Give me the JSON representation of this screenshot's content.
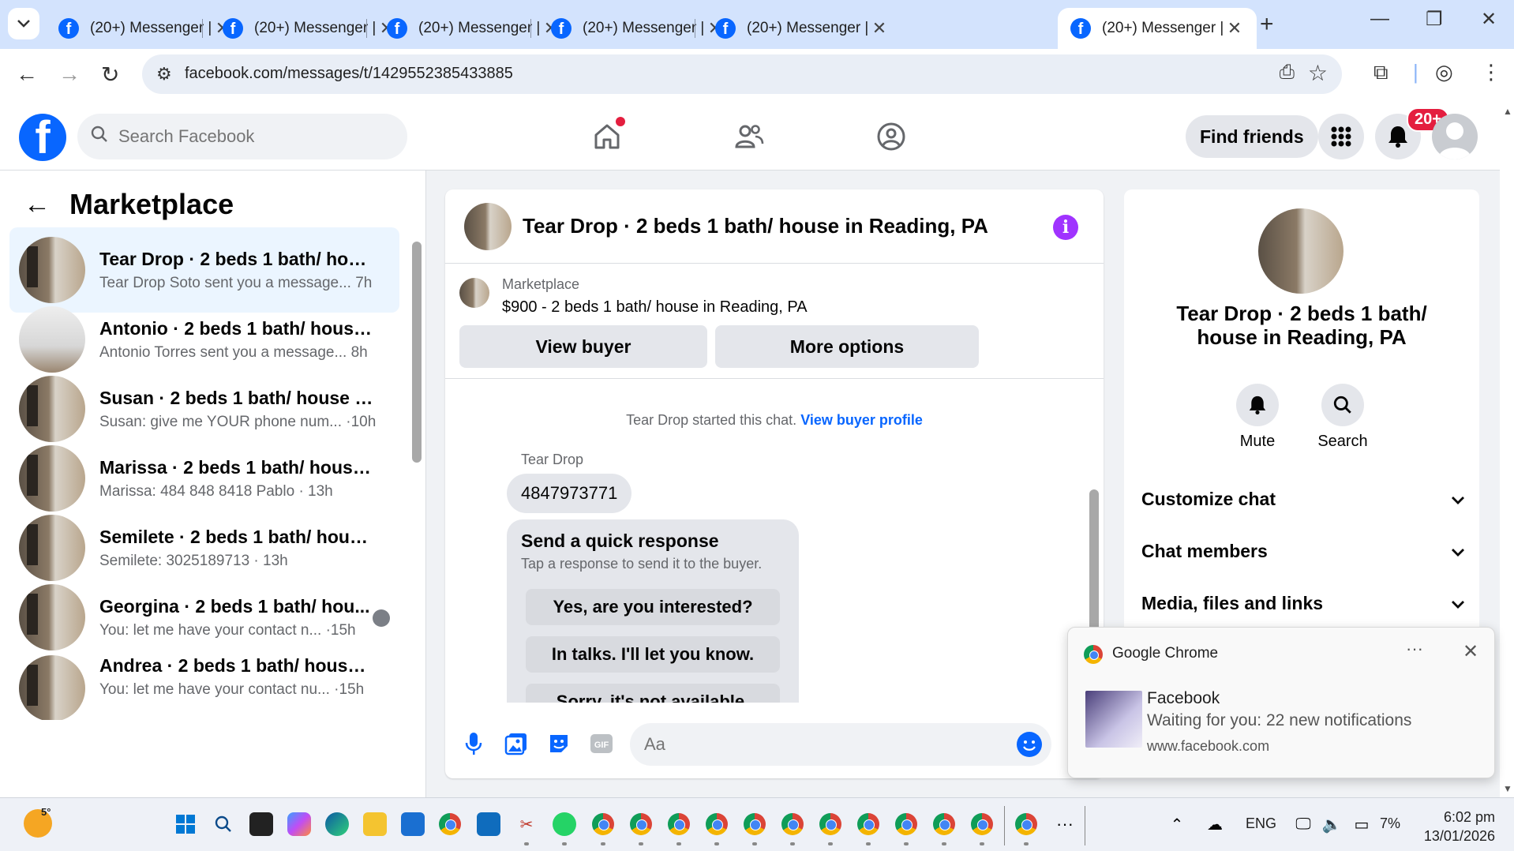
{
  "browser": {
    "tabs": [
      {
        "title": "(20+) Messenger |",
        "active": false
      },
      {
        "title": "(20+) Messenger |",
        "active": false
      },
      {
        "title": "(20+) Messenger |",
        "active": false
      },
      {
        "title": "(20+) Messenger |",
        "active": false
      },
      {
        "title": "(20+) Messenger |",
        "active": false
      },
      {
        "title": "(20+) Messenger |",
        "active": true
      }
    ],
    "url": "facebook.com/messages/t/1429552385433885"
  },
  "fb": {
    "search_placeholder": "Search Facebook",
    "find_friends": "Find friends",
    "notif_badge": "20+"
  },
  "sidebar": {
    "title": "Marketplace",
    "conversations": [
      {
        "name": "Tear Drop · 2 beds 1 bath/ house...",
        "preview": "Tear Drop Soto sent you a message... 7h"
      },
      {
        "name": "Antonio · 2 beds 1 bath/ house i...",
        "preview": "Antonio Torres sent you a message... 8h"
      },
      {
        "name": "Susan · 2 beds 1 bath/ house in ...",
        "preview": "Susan: give me YOUR phone num... ·10h"
      },
      {
        "name": "Marissa · 2 beds 1 bath/ house i...",
        "preview": "Marissa: 484 848 8418 Pablo · 13h"
      },
      {
        "name": "Semilete · 2 beds 1 bath/ house i...",
        "preview": "Semilete: 3025189713 · 13h"
      },
      {
        "name": "Georgina · 2 beds 1 bath/ hou...",
        "preview": "You: let me have your contact n... ·15h"
      },
      {
        "name": "Andrea · 2 beds 1 bath/ house in...",
        "preview": "You: let me have your contact nu... ·15h"
      }
    ]
  },
  "chat": {
    "title": "Tear Drop · 2 beds 1 bath/ house in Reading, PA",
    "marketplace_label": "Marketplace",
    "listing": "$900 - 2 beds 1 bath/ house in Reading, PA",
    "view_buyer": "View buyer",
    "more_options": "More options",
    "system_text": "Tear Drop started this chat.",
    "system_link": "View buyer profile",
    "sender": "Tear Drop",
    "message": "4847973771",
    "quick_title": "Send a quick response",
    "quick_sub": "Tap a response to send it to the buyer.",
    "quick_options": [
      "Yes, are you interested?",
      "In talks. I'll let you know.",
      "Sorry, it's not available."
    ],
    "composer_placeholder": "Aa"
  },
  "info": {
    "name": "Tear Drop · 2 beds 1 bath/ house in Reading, PA",
    "mute": "Mute",
    "search": "Search",
    "sections": [
      "Customize chat",
      "Chat members",
      "Media, files and links"
    ]
  },
  "toast": {
    "app": "Google Chrome",
    "title": "Facebook",
    "body": "Waiting for you: 22 new notifications",
    "source": "www.facebook.com"
  },
  "taskbar": {
    "weather": "5°",
    "lang": "ENG",
    "battery": "7%",
    "time": "6:02 pm",
    "date": "13/01/2026"
  }
}
